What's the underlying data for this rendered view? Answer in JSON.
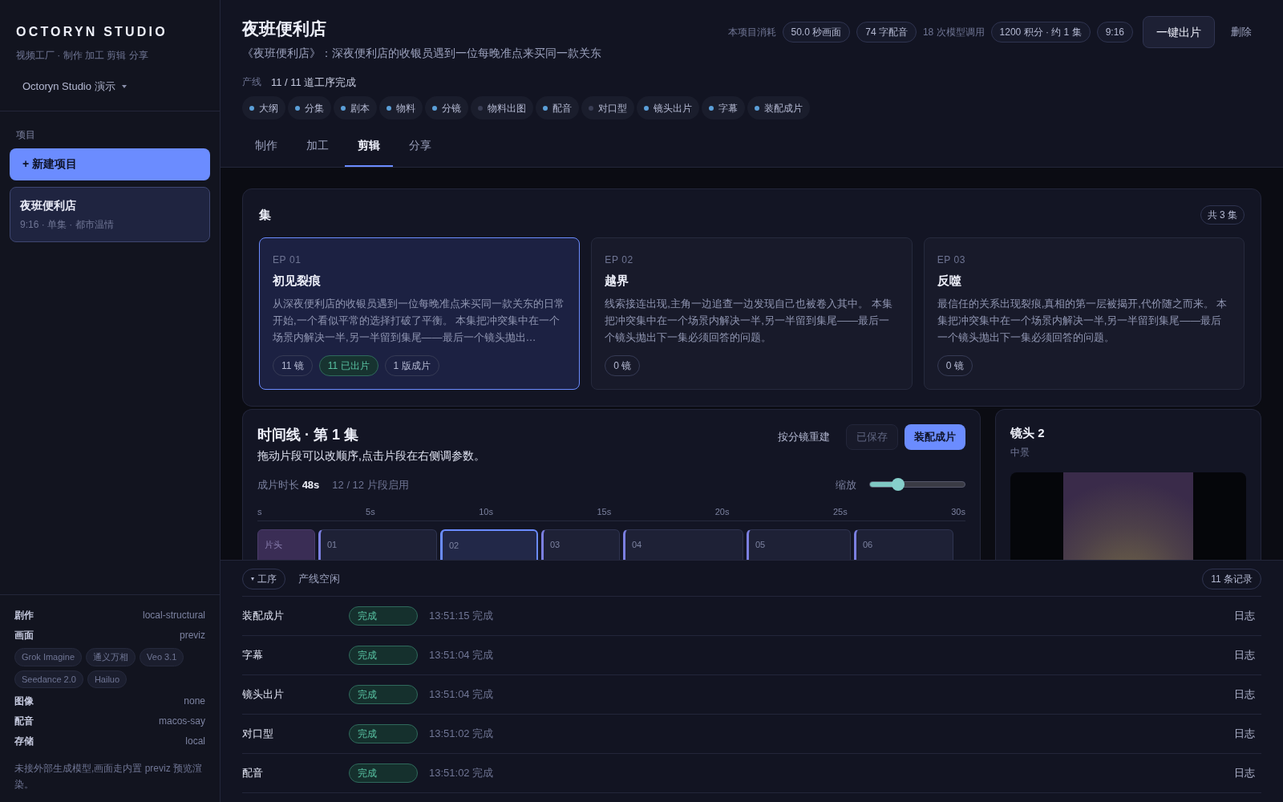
{
  "sidebar": {
    "brand": "OCTORYN STUDIO",
    "tagline": "视频工厂 · 制作 加工 剪辑 分享",
    "workspace": "Octoryn Studio 演示",
    "section_label": "项目",
    "new_project": "+ 新建项目",
    "projects": [
      {
        "title": "夜班便利店",
        "meta": "9:16 · 单集 · 都市温情",
        "selected": true
      }
    ],
    "settings": [
      {
        "kind": "pair",
        "label": "剧作",
        "value": "local-structural"
      },
      {
        "kind": "pair",
        "label": "画面",
        "value": "previz"
      },
      {
        "kind": "tags",
        "tags": [
          "Grok Imagine",
          "通义万相",
          "Veo 3.1",
          "Seedance 2.0",
          "Hailuo"
        ]
      },
      {
        "kind": "pair",
        "label": "图像",
        "value": "none"
      },
      {
        "kind": "pair",
        "label": "配音",
        "value": "macos-say"
      },
      {
        "kind": "pair",
        "label": "存储",
        "value": "local"
      }
    ],
    "note": "未接外部生成模型,画面走内置 previz 预览渲染。"
  },
  "header": {
    "title": "夜班便利店",
    "logline": "《夜班便利店》：深夜便利店的收银员遇到一位每晚准点来买同一款关东",
    "usage_label": "本项目消耗",
    "usage": [
      {
        "kind": "chip",
        "text": "50.0 秒画面"
      },
      {
        "kind": "chip",
        "text": "74 字配音"
      },
      {
        "kind": "plain",
        "text": "18 次模型调用"
      },
      {
        "kind": "chip",
        "text": "1200 积分 · 约 1 集"
      },
      {
        "kind": "chip",
        "text": "9:16"
      }
    ],
    "primary_button": "一键出片",
    "delete_button": "删除",
    "pipeline_label": "产线",
    "pipeline_status": "11 / 11 道工序完成",
    "stages": [
      {
        "name": "大纲",
        "done": true
      },
      {
        "name": "分集",
        "done": true
      },
      {
        "name": "剧本",
        "done": true
      },
      {
        "name": "物料",
        "done": true
      },
      {
        "name": "分镜",
        "done": true
      },
      {
        "name": "物料出图",
        "done": false
      },
      {
        "name": "配音",
        "done": true
      },
      {
        "name": "对口型",
        "done": false
      },
      {
        "name": "镜头出片",
        "done": true
      },
      {
        "name": "字幕",
        "done": true
      },
      {
        "name": "装配成片",
        "done": true
      }
    ]
  },
  "tabs": [
    {
      "label": "制作",
      "selected": false
    },
    {
      "label": "加工",
      "selected": false
    },
    {
      "label": "剪辑",
      "selected": true
    },
    {
      "label": "分享",
      "selected": false
    }
  ],
  "episodes": {
    "title": "集",
    "count": "共 3 集",
    "items": [
      {
        "code": "EP 01",
        "title": "初见裂痕",
        "summary": "从深夜便利店的收银员遇到一位每晚准点来买同一款关东的日常开始,一个看似平常的选择打破了平衡。 本集把冲突集中在一个场景内解决一半,另一半留到集尾——最后一个镜头抛出…",
        "selected": true,
        "badges": [
          {
            "text": "11 镜",
            "highlight": false
          },
          {
            "text": "11 已出片",
            "highlight": true
          },
          {
            "text": "1 版成片",
            "highlight": false
          }
        ]
      },
      {
        "code": "EP 02",
        "title": "越界",
        "summary": "线索接连出现,主角一边追查一边发现自己也被卷入其中。 本集把冲突集中在一个场景内解决一半,另一半留到集尾——最后一个镜头抛出下一集必须回答的问题。",
        "selected": false,
        "badges": [
          {
            "text": "0 镜",
            "highlight": false
          }
        ]
      },
      {
        "code": "EP 03",
        "title": "反噬",
        "summary": "最信任的关系出现裂痕,真相的第一层被揭开,代价随之而来。 本集把冲突集中在一个场景内解决一半,另一半留到集尾——最后一个镜头抛出下一集必须回答的问题。",
        "selected": false,
        "badges": [
          {
            "text": "0 镜",
            "highlight": false
          }
        ]
      }
    ]
  },
  "timeline": {
    "title": "时间线 · 第 1 集",
    "hint": "拖动片段可以改顺序,点击片段在右侧调参数。",
    "rebuild_button": "按分镜重建",
    "saved_button": "已保存",
    "assemble_button": "装配成片",
    "duration_label": "成片时长",
    "duration": "48s",
    "enabled": "12 / 12 片段启用",
    "zoom_label": "缩放",
    "zoom": {
      "level": 0.3
    },
    "ticks": [
      "s",
      "5s",
      "10s",
      "15s",
      "20s",
      "25s",
      "30s"
    ],
    "clips": [
      {
        "kind": "intro",
        "label": "片头",
        "selected": false
      },
      {
        "kind": "shot",
        "label": "01",
        "selected": false
      },
      {
        "kind": "shot",
        "label": "02",
        "selected": true
      },
      {
        "kind": "shot",
        "label": "03",
        "selected": false
      },
      {
        "kind": "shot",
        "label": "04",
        "selected": false
      },
      {
        "kind": "shot",
        "label": "05",
        "selected": false
      },
      {
        "kind": "shot",
        "label": "06",
        "selected": false
      }
    ]
  },
  "inspector": {
    "title": "镜头 2",
    "subtitle": "中景"
  },
  "jobs": {
    "toggle": "工序",
    "toggle_caret": "▾",
    "status": "产线空闲",
    "count": "11 条记录",
    "rows": [
      {
        "name": "装配成片",
        "status": "完成",
        "time": "13:51:15 完成",
        "action": "日志"
      },
      {
        "name": "字幕",
        "status": "完成",
        "time": "13:51:04 完成",
        "action": "日志"
      },
      {
        "name": "镜头出片",
        "status": "完成",
        "time": "13:51:04 完成",
        "action": "日志"
      },
      {
        "name": "对口型",
        "status": "完成",
        "time": "13:51:02 完成",
        "action": "日志"
      },
      {
        "name": "配音",
        "status": "完成",
        "time": "13:51:02 完成",
        "action": "日志"
      }
    ]
  }
}
